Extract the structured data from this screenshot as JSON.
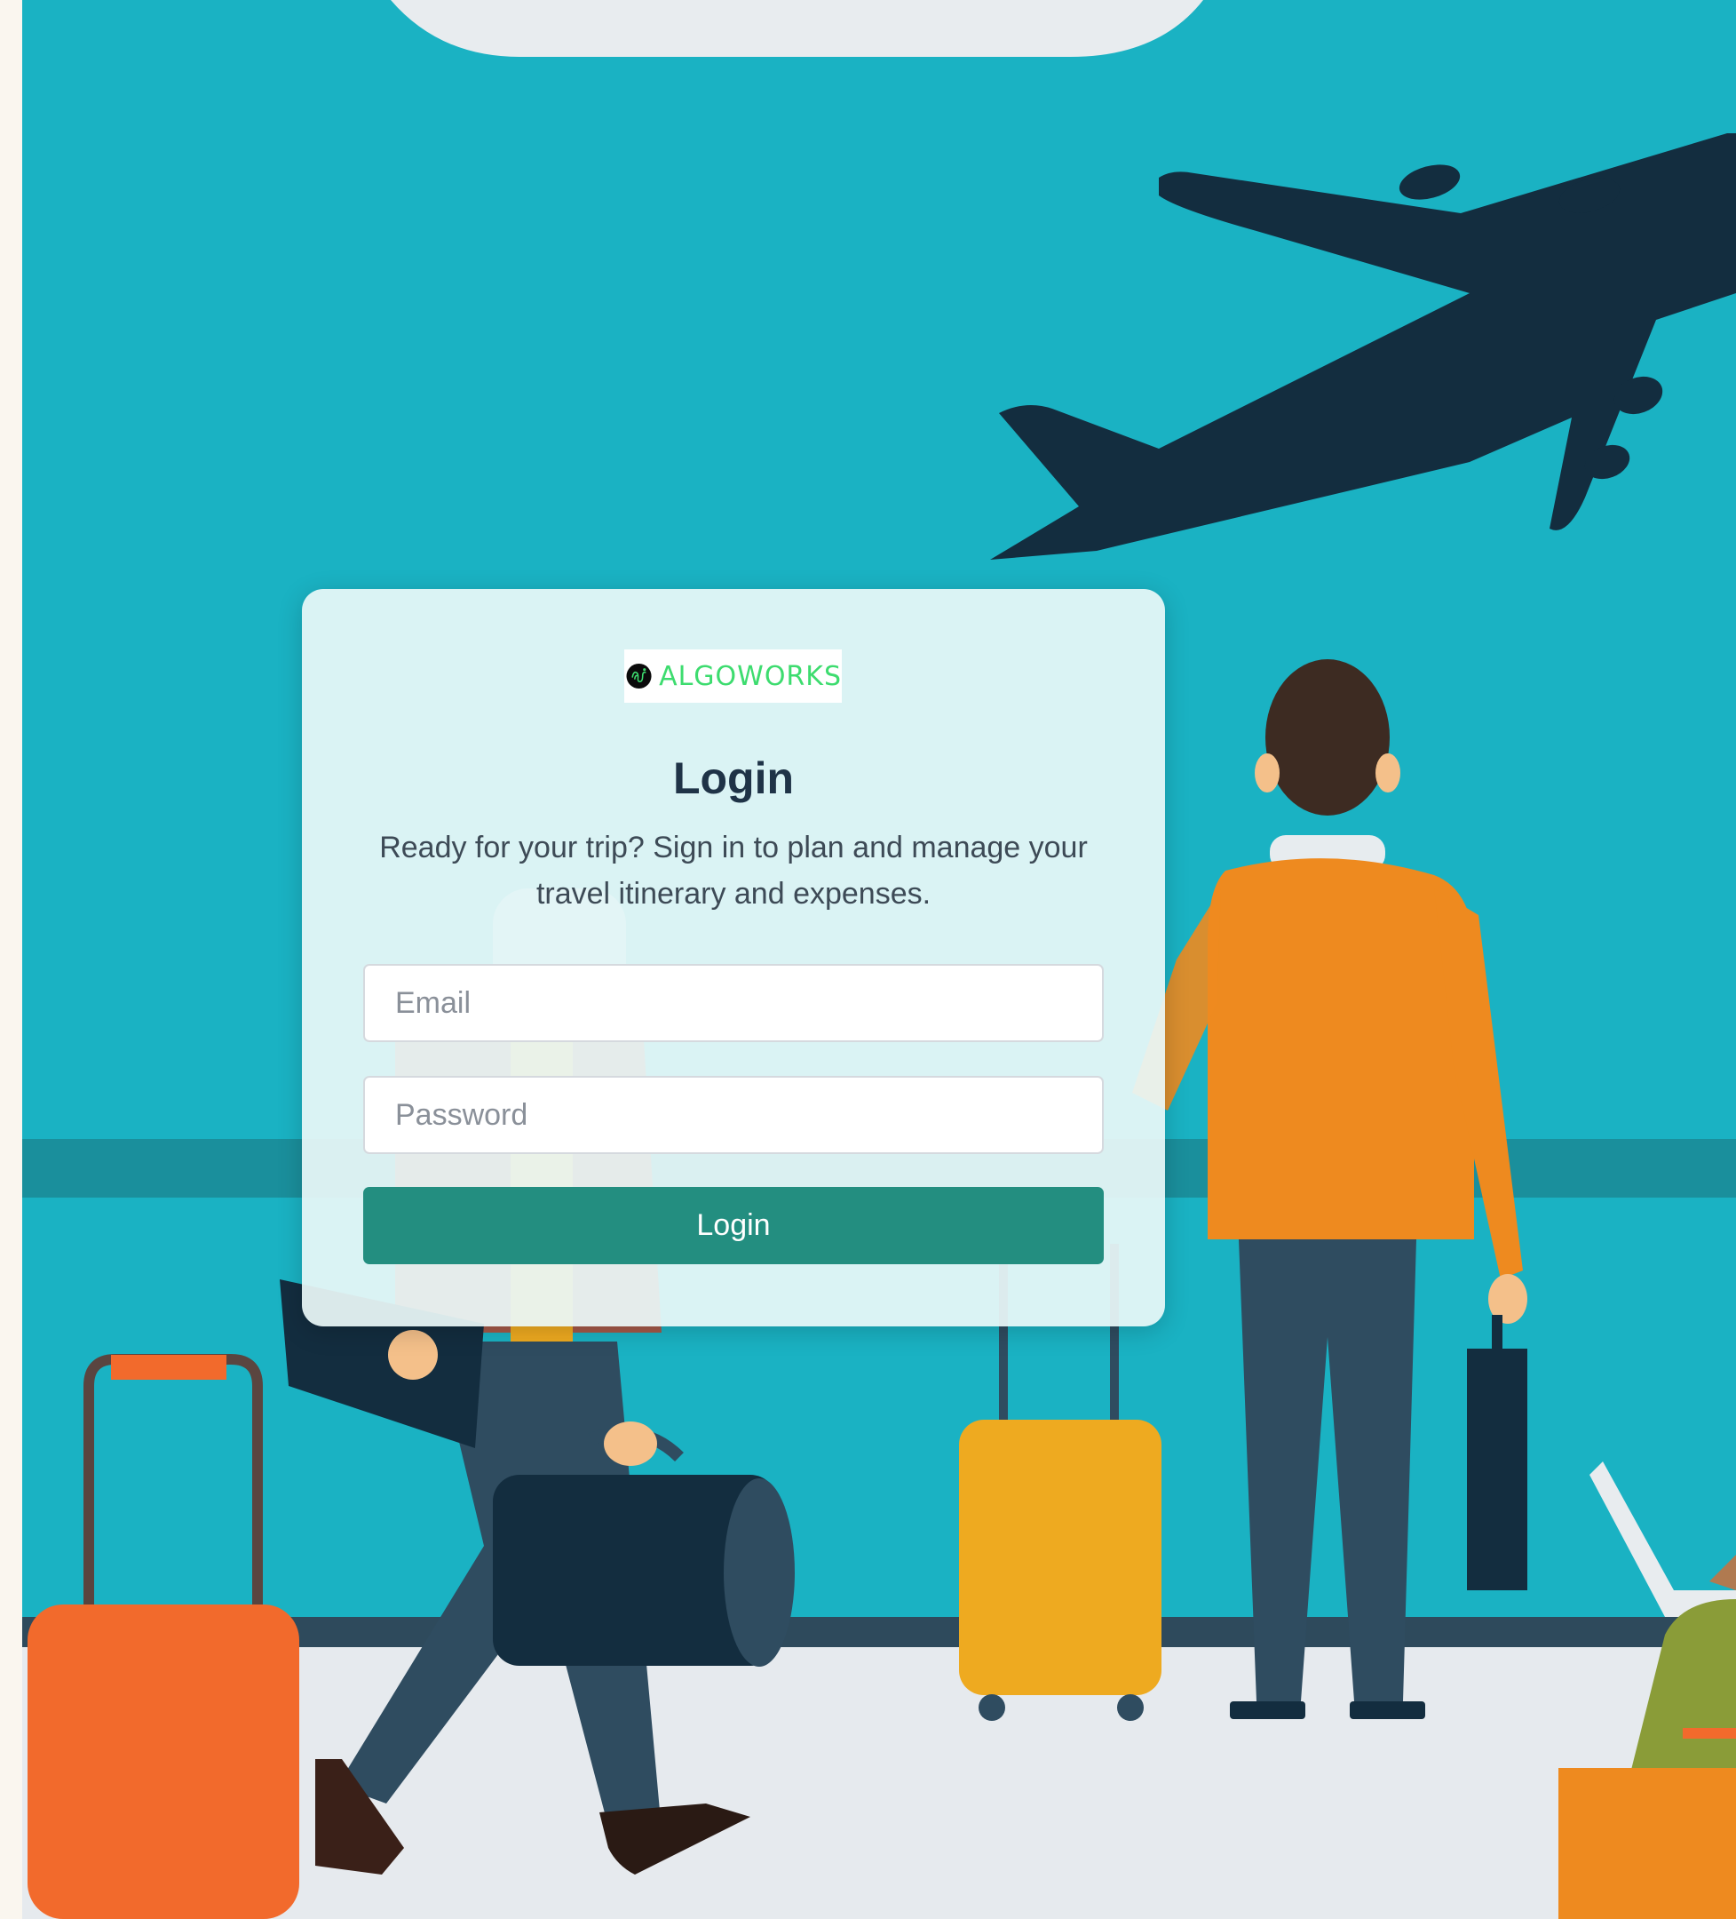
{
  "brand": {
    "name": "ALGOWORKS",
    "accent_color": "#3ddc6f",
    "logo_icon": "algoworks-logo-icon"
  },
  "login": {
    "title": "Login",
    "subtitle": "Ready for your trip? Sign in to plan and manage your travel itinerary and expenses.",
    "email_placeholder": "Email",
    "password_placeholder": "Password",
    "button_label": "Login",
    "button_color": "#238e80"
  },
  "background": {
    "illustration": "airport-travelers-illustration",
    "sky_color": "#1ab2c3",
    "floor_color": "#e6eaee"
  }
}
